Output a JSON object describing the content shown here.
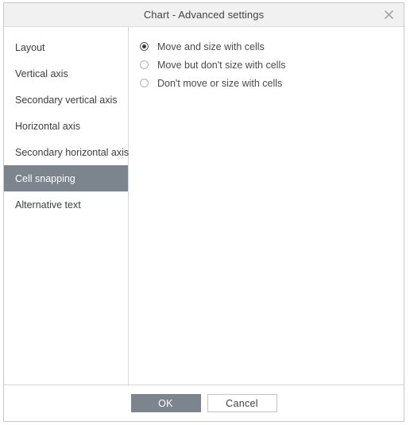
{
  "dialog": {
    "title": "Chart - Advanced settings",
    "close_icon": "close-icon"
  },
  "sidebar": {
    "items": [
      {
        "label": "Layout",
        "selected": false
      },
      {
        "label": "Vertical axis",
        "selected": false
      },
      {
        "label": "Secondary vertical axis",
        "selected": false
      },
      {
        "label": "Horizontal axis",
        "selected": false
      },
      {
        "label": "Secondary horizontal axis",
        "selected": false
      },
      {
        "label": "Cell snapping",
        "selected": true
      },
      {
        "label": "Alternative text",
        "selected": false
      }
    ]
  },
  "panel": {
    "options": [
      {
        "label": "Move and size with cells",
        "checked": true
      },
      {
        "label": "Move but don't size with cells",
        "checked": false
      },
      {
        "label": "Don't move or size with cells",
        "checked": false
      }
    ]
  },
  "footer": {
    "ok_label": "OK",
    "cancel_label": "Cancel"
  },
  "colors": {
    "accent": "#7c848d",
    "titlebar_bg": "#f1f1f1",
    "border": "#d6d6d6",
    "text": "#3d3d3d"
  }
}
